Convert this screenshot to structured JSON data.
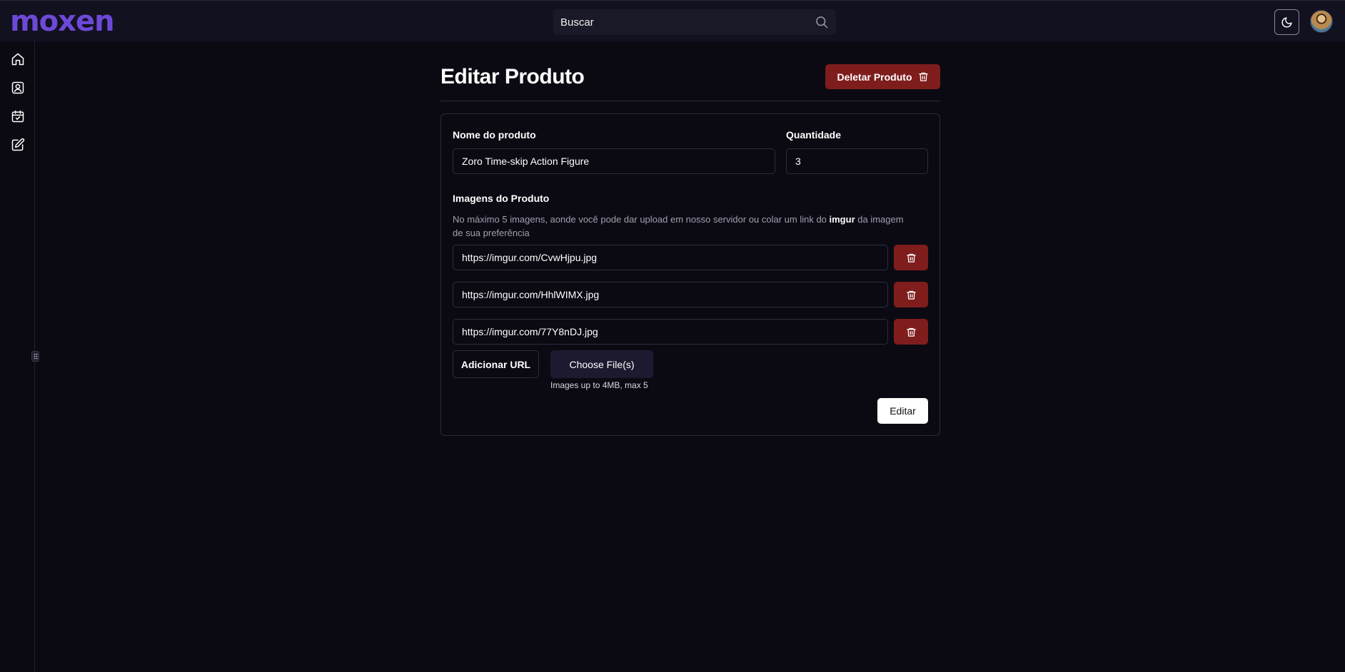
{
  "app": {
    "logo": "moxen"
  },
  "header": {
    "search_placeholder": "Buscar"
  },
  "sidebar": {
    "items": [
      {
        "icon": "home-icon"
      },
      {
        "icon": "user-card-icon"
      },
      {
        "icon": "calendar-check-icon"
      },
      {
        "icon": "edit-icon"
      }
    ]
  },
  "page": {
    "title": "Editar Produto",
    "delete_label": "Deletar Produto"
  },
  "form": {
    "name_label": "Nome do produto",
    "name_value": "Zoro Time-skip Action Figure",
    "qty_label": "Quantidade",
    "qty_value": "3",
    "images_label": "Imagens do Produto",
    "images_help_before": "No máximo 5 imagens, aonde você pode dar upload em nosso servidor ou colar um link do ",
    "images_help_bold": "imgur",
    "images_help_after": " da imagem de sua preferência",
    "image_urls": [
      "https://imgur.com/CvwHjpu.jpg",
      "https://imgur.com/HhlWIMX.jpg",
      "https://imgur.com/77Y8nDJ.jpg"
    ],
    "add_url_label": "Adicionar URL",
    "choose_files_label": "Choose File(s)",
    "file_hint": "Images up to 4MB, max 5",
    "submit_label": "Editar"
  },
  "colors": {
    "brand": "#6d49d9",
    "danger": "#7f1d1d",
    "background": "#0b0a13"
  }
}
